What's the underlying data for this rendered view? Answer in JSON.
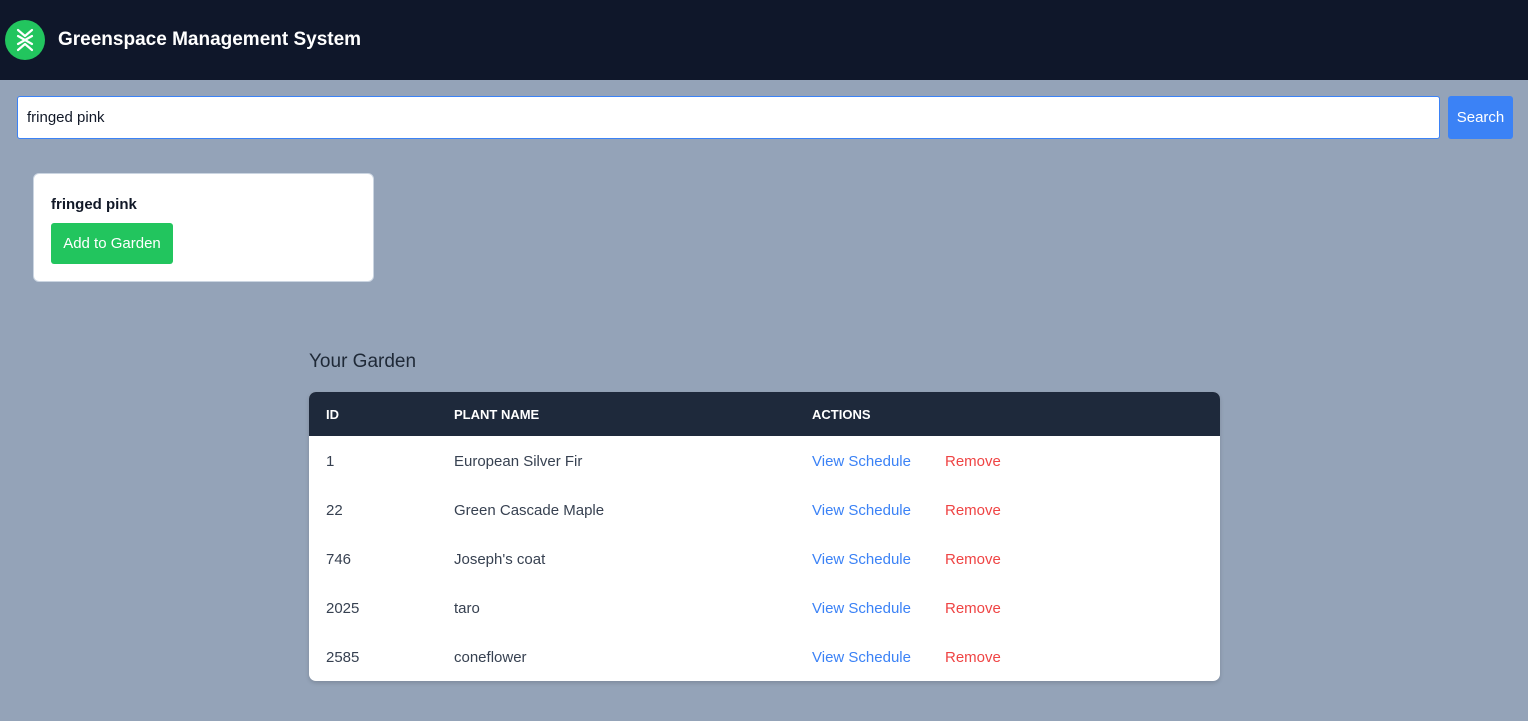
{
  "header": {
    "title": "Greenspace Management System",
    "logo_icon": "dna-leaf-icon",
    "logo_color": "#22c55e"
  },
  "search": {
    "value": "fringed pink",
    "button_label": "Search"
  },
  "result": {
    "name": "fringed pink",
    "add_label": "Add to Garden"
  },
  "garden": {
    "heading": "Your Garden",
    "columns": [
      "ID",
      "PLANT NAME",
      "ACTIONS"
    ],
    "rows": [
      {
        "id": "1",
        "name": "European Silver Fir",
        "view": "View Schedule",
        "remove": "Remove"
      },
      {
        "id": "22",
        "name": "Green Cascade Maple",
        "view": "View Schedule",
        "remove": "Remove"
      },
      {
        "id": "746",
        "name": "Joseph's coat",
        "view": "View Schedule",
        "remove": "Remove"
      },
      {
        "id": "2025",
        "name": "taro",
        "view": "View Schedule",
        "remove": "Remove"
      },
      {
        "id": "2585",
        "name": "coneflower",
        "view": "View Schedule",
        "remove": "Remove"
      }
    ]
  },
  "colors": {
    "topbar": "#0f172a",
    "background": "#94a3b8",
    "accent_blue": "#3b82f6",
    "accent_green": "#22c55e",
    "danger_red": "#ef4444"
  }
}
